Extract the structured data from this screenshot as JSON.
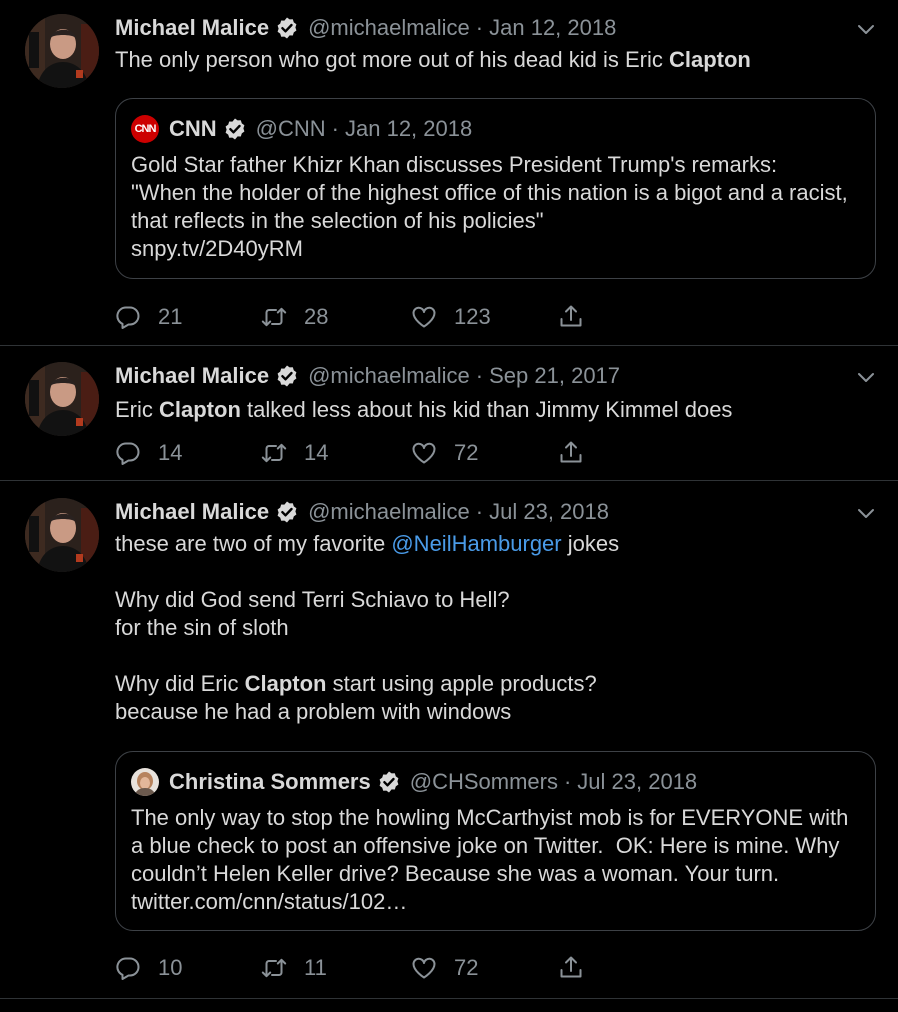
{
  "tweets": [
    {
      "author": "Michael Malice",
      "handle": "@michaelmalice",
      "sep": "·",
      "date": "Jan 12, 2018",
      "text_parts": [
        "The only person who got more out of his dead kid is Eric ",
        "Clapton"
      ],
      "quote": {
        "author": "CNN",
        "handle": "@CNN",
        "sep": "·",
        "date": "Jan 12, 2018",
        "logo_text": "CNN",
        "text": "Gold Star father Khizr Khan discusses President Trump's remarks:\n\"When the holder of the highest office of this nation is a bigot and a racist, that reflects in the selection of his policies\"\nsnpy.tv/2D40yRM"
      },
      "replies": "21",
      "retweets": "28",
      "likes": "123"
    },
    {
      "author": "Michael Malice",
      "handle": "@michaelmalice",
      "sep": "·",
      "date": "Sep 21, 2017",
      "text_parts": [
        "Eric ",
        "Clapton",
        " talked less about his kid than Jimmy Kimmel does"
      ],
      "replies": "14",
      "retweets": "14",
      "likes": "72"
    },
    {
      "author": "Michael Malice",
      "handle": "@michaelmalice",
      "sep": "·",
      "date": "Jul 23, 2018",
      "text_parts": [
        "these are two of my favorite ",
        "@NeilHamburger",
        " jokes\n\nWhy did God send Terri Schiavo to Hell?\nfor the sin of sloth\n\nWhy did Eric ",
        "Clapton",
        " start using apple products?\nbecause he had a problem with windows"
      ],
      "quote": {
        "author": "Christina Sommers",
        "handle": "@CHSommers",
        "sep": "·",
        "date": "Jul 23, 2018",
        "text": "The only way to stop the howling McCarthyist mob is for EVERYONE with a blue check to post an offensive joke on Twitter.  OK: Here is mine. Why couldn’t Helen Keller drive? Because she was a woman. Your turn. twitter.com/cnn/status/102…"
      },
      "replies": "10",
      "retweets": "11",
      "likes": "72"
    }
  ],
  "icons": {
    "reply": "reply-icon",
    "retweet": "retweet-icon",
    "like": "heart-icon",
    "share": "share-icon",
    "verified": "verified-badge-icon",
    "menu": "chevron-down-icon"
  },
  "colors": {
    "background": "#000000",
    "text": "#d9d9d9",
    "muted": "#8b9298",
    "mention": "#4a9be8",
    "cnn_red": "#cc0000",
    "divider": "#2f3336"
  }
}
